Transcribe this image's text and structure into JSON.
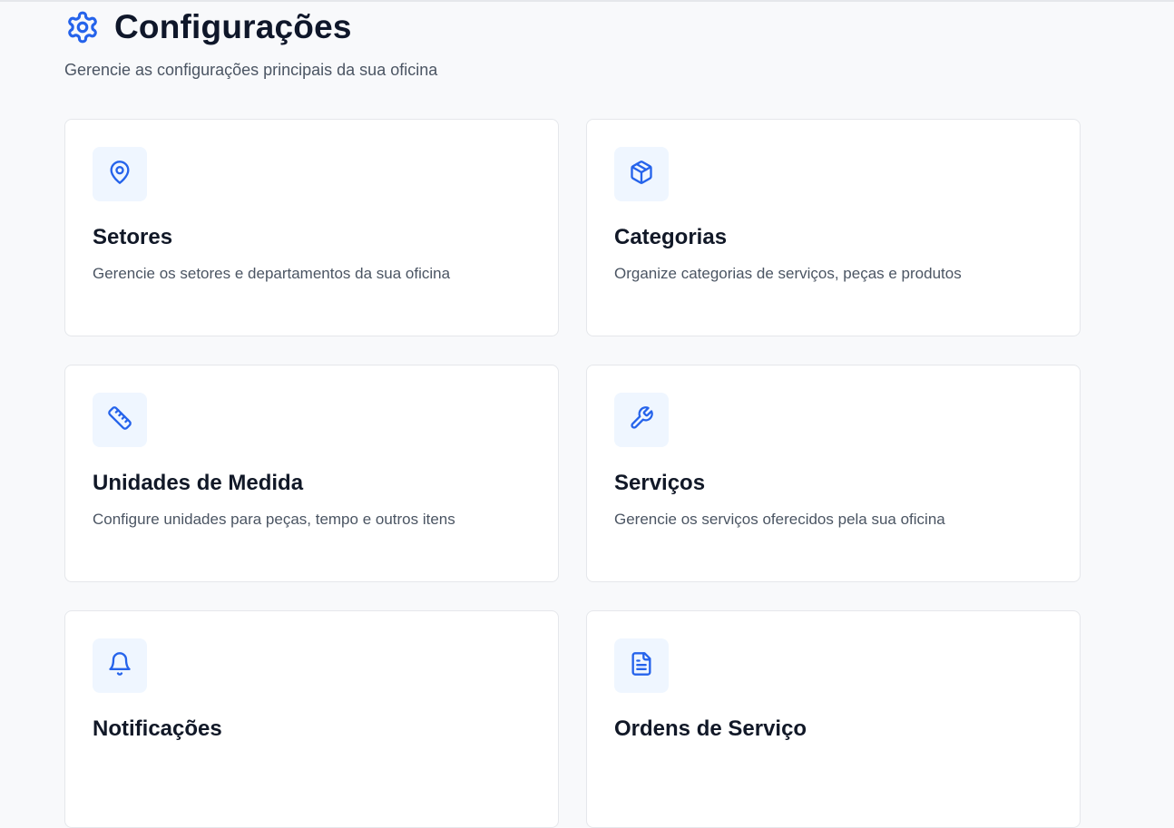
{
  "header": {
    "title": "Configurações",
    "subtitle": "Gerencie as configurações principais da sua oficina",
    "icon": "gear-icon"
  },
  "colors": {
    "accent": "#2563eb",
    "icon_bg": "#eff6ff",
    "page_bg": "#f8f9fb",
    "card_bg": "#ffffff",
    "title": "#0f172a",
    "muted": "#4b5563"
  },
  "cards": [
    {
      "title": "Setores",
      "description": "Gerencie os setores e departamentos da sua oficina",
      "icon": "map-pin-icon"
    },
    {
      "title": "Categorias",
      "description": "Organize categorias de serviços, peças e produtos",
      "icon": "package-icon"
    },
    {
      "title": "Unidades de Medida",
      "description": "Configure unidades para peças, tempo e outros itens",
      "icon": "ruler-icon"
    },
    {
      "title": "Serviços",
      "description": "Gerencie os serviços oferecidos pela sua oficina",
      "icon": "wrench-icon"
    },
    {
      "title": "Notificações",
      "description": "",
      "icon": "bell-icon"
    },
    {
      "title": "Ordens de Serviço",
      "description": "",
      "icon": "file-text-icon"
    }
  ]
}
